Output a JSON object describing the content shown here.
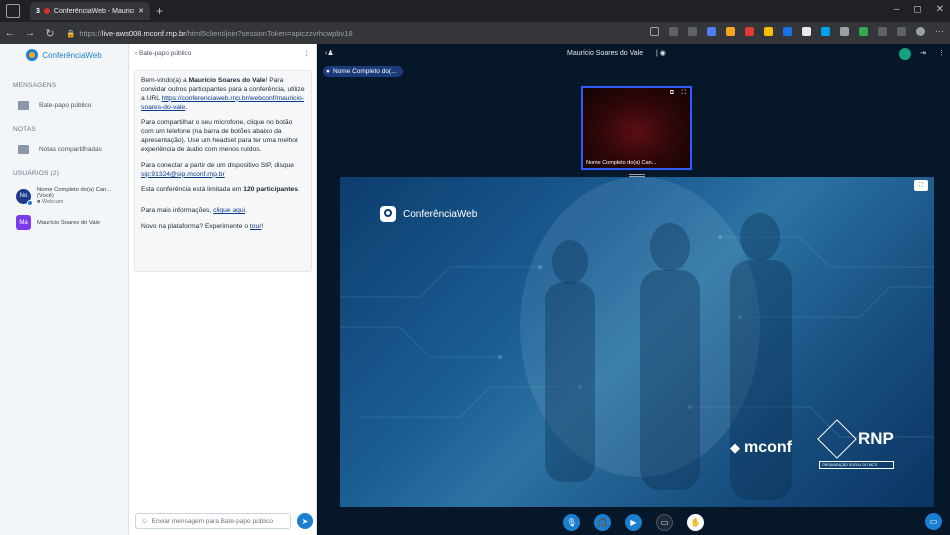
{
  "browser": {
    "tab_count": "3",
    "tab_title": "ConferênciaWeb - Mauricio",
    "url_prefix": "https://",
    "url_host": "live-aws008.mconf.rnp.br",
    "url_path": "/html5client/join?sessionToken=apiczzvrhcwpbv18"
  },
  "sidebar": {
    "brand": "ConferênciaWeb",
    "messages_title": "MENSAGENS",
    "public_chat": "Bate-papo público",
    "notes_title": "NOTAS",
    "shared_notes": "Notas compartilhadas",
    "users_title": "USUÁRIOS  (2)",
    "users": [
      {
        "initials": "No",
        "name": "Nome Completo do(a) Can... (Você)",
        "status": "Webcam",
        "color": "#1e3a8a"
      },
      {
        "initials": "Ma",
        "name": "Maurício Soares do Vale",
        "status": "",
        "color": "#7c3aed"
      }
    ]
  },
  "chat": {
    "back_label": "Bate-papo público",
    "p1_pre": "Bem-vindo(a) a ",
    "p1_bold": "Maurício Soares do Vale",
    "p1_post": "! Para convidar outros participantes para a conferência, utilize a URL",
    "p1_link": "https://conferenciaweb.rnp.br/webconf/mauricio-soares-do-vale",
    "p1_end": ".",
    "p2": "Para compartilhar o seu microfone, clique no botão com um telefone (na barra de botões abaixo da apresentação). Use um headset para ter uma melhor experiência de áudio com menos ruídos.",
    "p3": "Para conectar a partir de um dispositivo SIP, disque",
    "p3_link": "sip:91324@sip.mconf.rnp.br",
    "p4_pre": "Esta conferência está limitada em ",
    "p4_bold": "120 participantes",
    "p4_end": ".",
    "p5_pre": "Para mais informações, ",
    "p5_link": "clique aqui",
    "p5_end": ".",
    "p6_pre": "Novo na plataforma? Experimente o ",
    "p6_link": "tour",
    "p6_end": "!",
    "input_placeholder": "Enviar mensagem para Bate-papo público"
  },
  "main": {
    "meeting_title": "Maurício Soares do Vale",
    "presenter_pill": "Nome Completo do(...",
    "webcam_label": "Nome Completo do(a) Can...",
    "slide_brand": "ConferênciaWeb",
    "logo_mconf": "mconf",
    "logo_rnp": "RNP",
    "logo_rnp_sub": "ORGANIZAÇÃO SOCIAL DO MCTI"
  }
}
